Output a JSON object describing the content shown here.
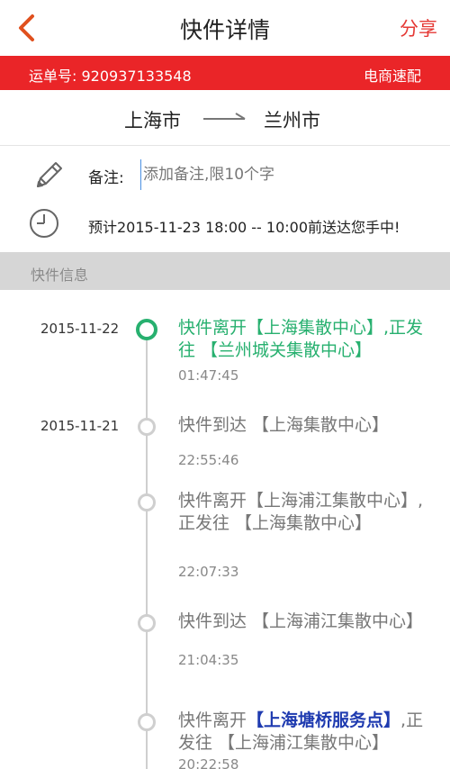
{
  "header": {
    "title": "快件详情",
    "share_label": "分享"
  },
  "waybill": {
    "label": "运单号:",
    "number": "920937133548",
    "service": "电商速配"
  },
  "route": {
    "from": "上海市",
    "to": "兰州市"
  },
  "note": {
    "label": "备注:",
    "placeholder": "添加备注,限10个字"
  },
  "eta": {
    "text": "预计2015-11-23 18:00 -- 10:00前送达您手中!"
  },
  "section": {
    "title": "快件信息"
  },
  "colors": {
    "brand_red": "#ea2528",
    "active_green": "#27b06f",
    "highlight_blue": "#1f3bb0"
  },
  "timeline": [
    {
      "date": "2015-11-22",
      "pre": "快件离开【上海集散中心】,正发往 【兰州城关集散中心】",
      "highlight": "",
      "post": "",
      "time": "01:47:45",
      "active": true
    },
    {
      "date": "2015-11-21",
      "pre": "快件到达 【上海集散中心】",
      "highlight": "",
      "post": "",
      "time": "22:55:46",
      "active": false
    },
    {
      "date": "",
      "pre": "快件离开【上海浦江集散中心】,正发往 【上海集散中心】",
      "highlight": "",
      "post": "",
      "time": "22:07:33",
      "active": false
    },
    {
      "date": "",
      "pre": "快件到达 【上海浦江集散中心】",
      "highlight": "",
      "post": "",
      "time": "21:04:35",
      "active": false
    },
    {
      "date": "",
      "pre": "快件离开",
      "highlight": "【上海塘桥服务点】",
      "post": ",正发往 【上海浦江集散中心】",
      "time": "20:22:58",
      "active": false
    }
  ]
}
